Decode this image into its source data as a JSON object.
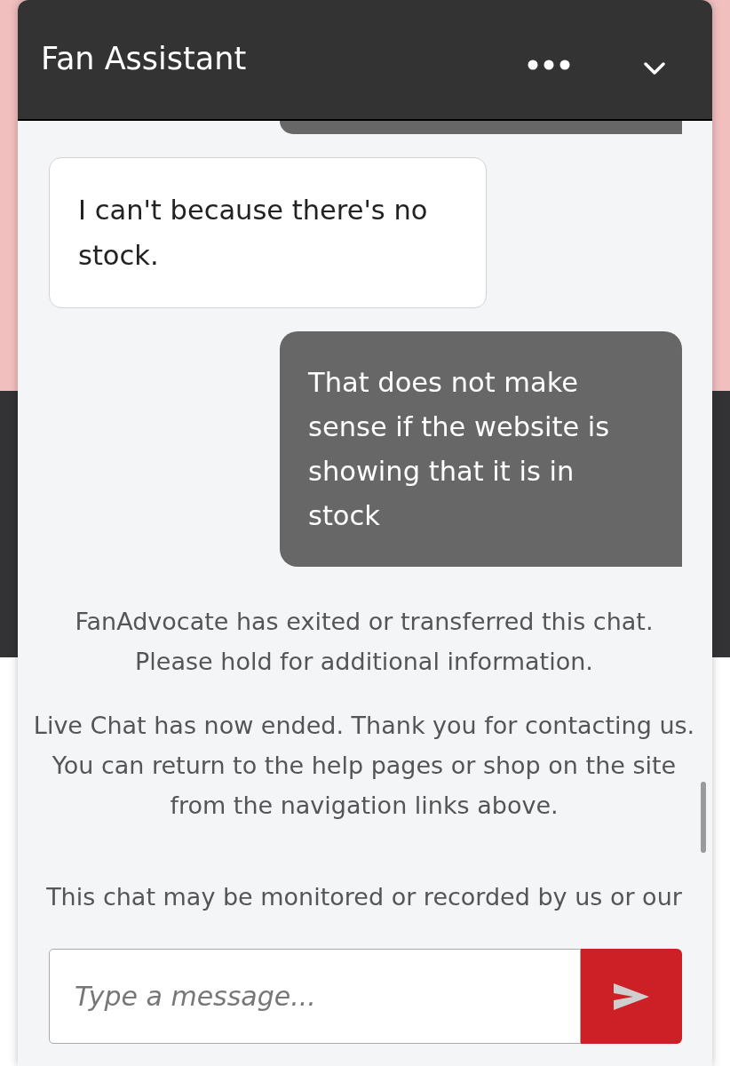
{
  "header": {
    "title": "Fan Assistant"
  },
  "messages": [
    {
      "kind": "agent",
      "text": "I can't because there's no stock."
    },
    {
      "kind": "user",
      "text": "That does not make sense if the website is showing that it is in stock"
    },
    {
      "kind": "system",
      "text": "FanAdvocate has exited or transferred this chat.\nPlease hold for additional information."
    },
    {
      "kind": "system",
      "text": "Live Chat has now ended. Thank you for contacting us.\nYou can return to the help pages or shop on the site from the navigation links above."
    },
    {
      "kind": "disclaimer",
      "text": "This chat may be monitored or recorded by us or our"
    }
  ],
  "composer": {
    "placeholder": "Type a message..."
  }
}
